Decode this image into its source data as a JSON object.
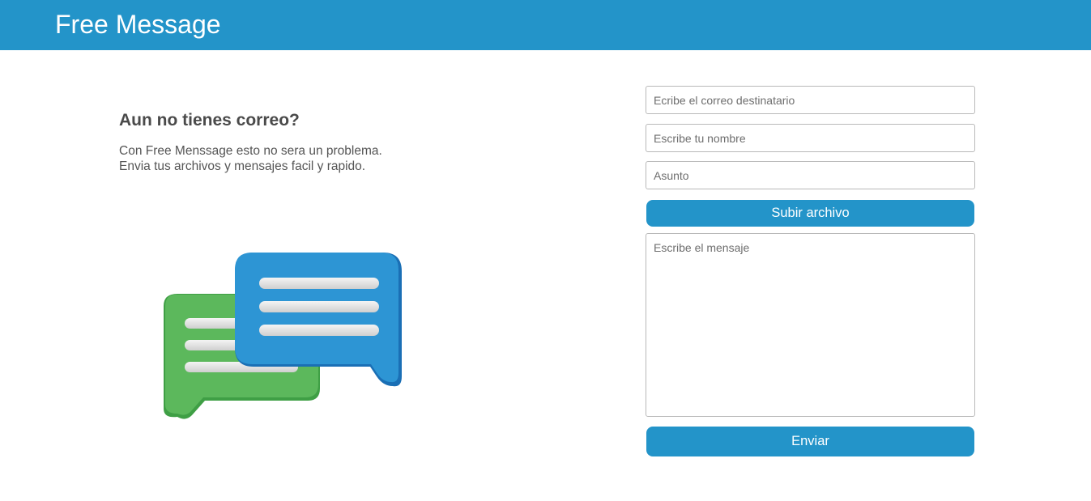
{
  "header": {
    "title": "Free Message"
  },
  "intro": {
    "heading": "Aun no tienes correo?",
    "line1": "Con Free Menssage esto no sera un problema.",
    "line2": "Envia tus archivos y mensajes facil y rapido."
  },
  "illustration": {
    "icon": "chat-bubbles-icon",
    "colors": {
      "green": "#4caf50",
      "blue": "#2394c9"
    }
  },
  "form": {
    "recipient_placeholder": "Ecribe el correo destinatario",
    "name_placeholder": "Escribe tu nombre",
    "subject_placeholder": "Asunto",
    "upload_label": "Subir archivo",
    "message_placeholder": "Escribe el mensaje",
    "send_label": "Enviar"
  },
  "colors": {
    "accent": "#2394c9",
    "text": "#4a4a4a"
  }
}
